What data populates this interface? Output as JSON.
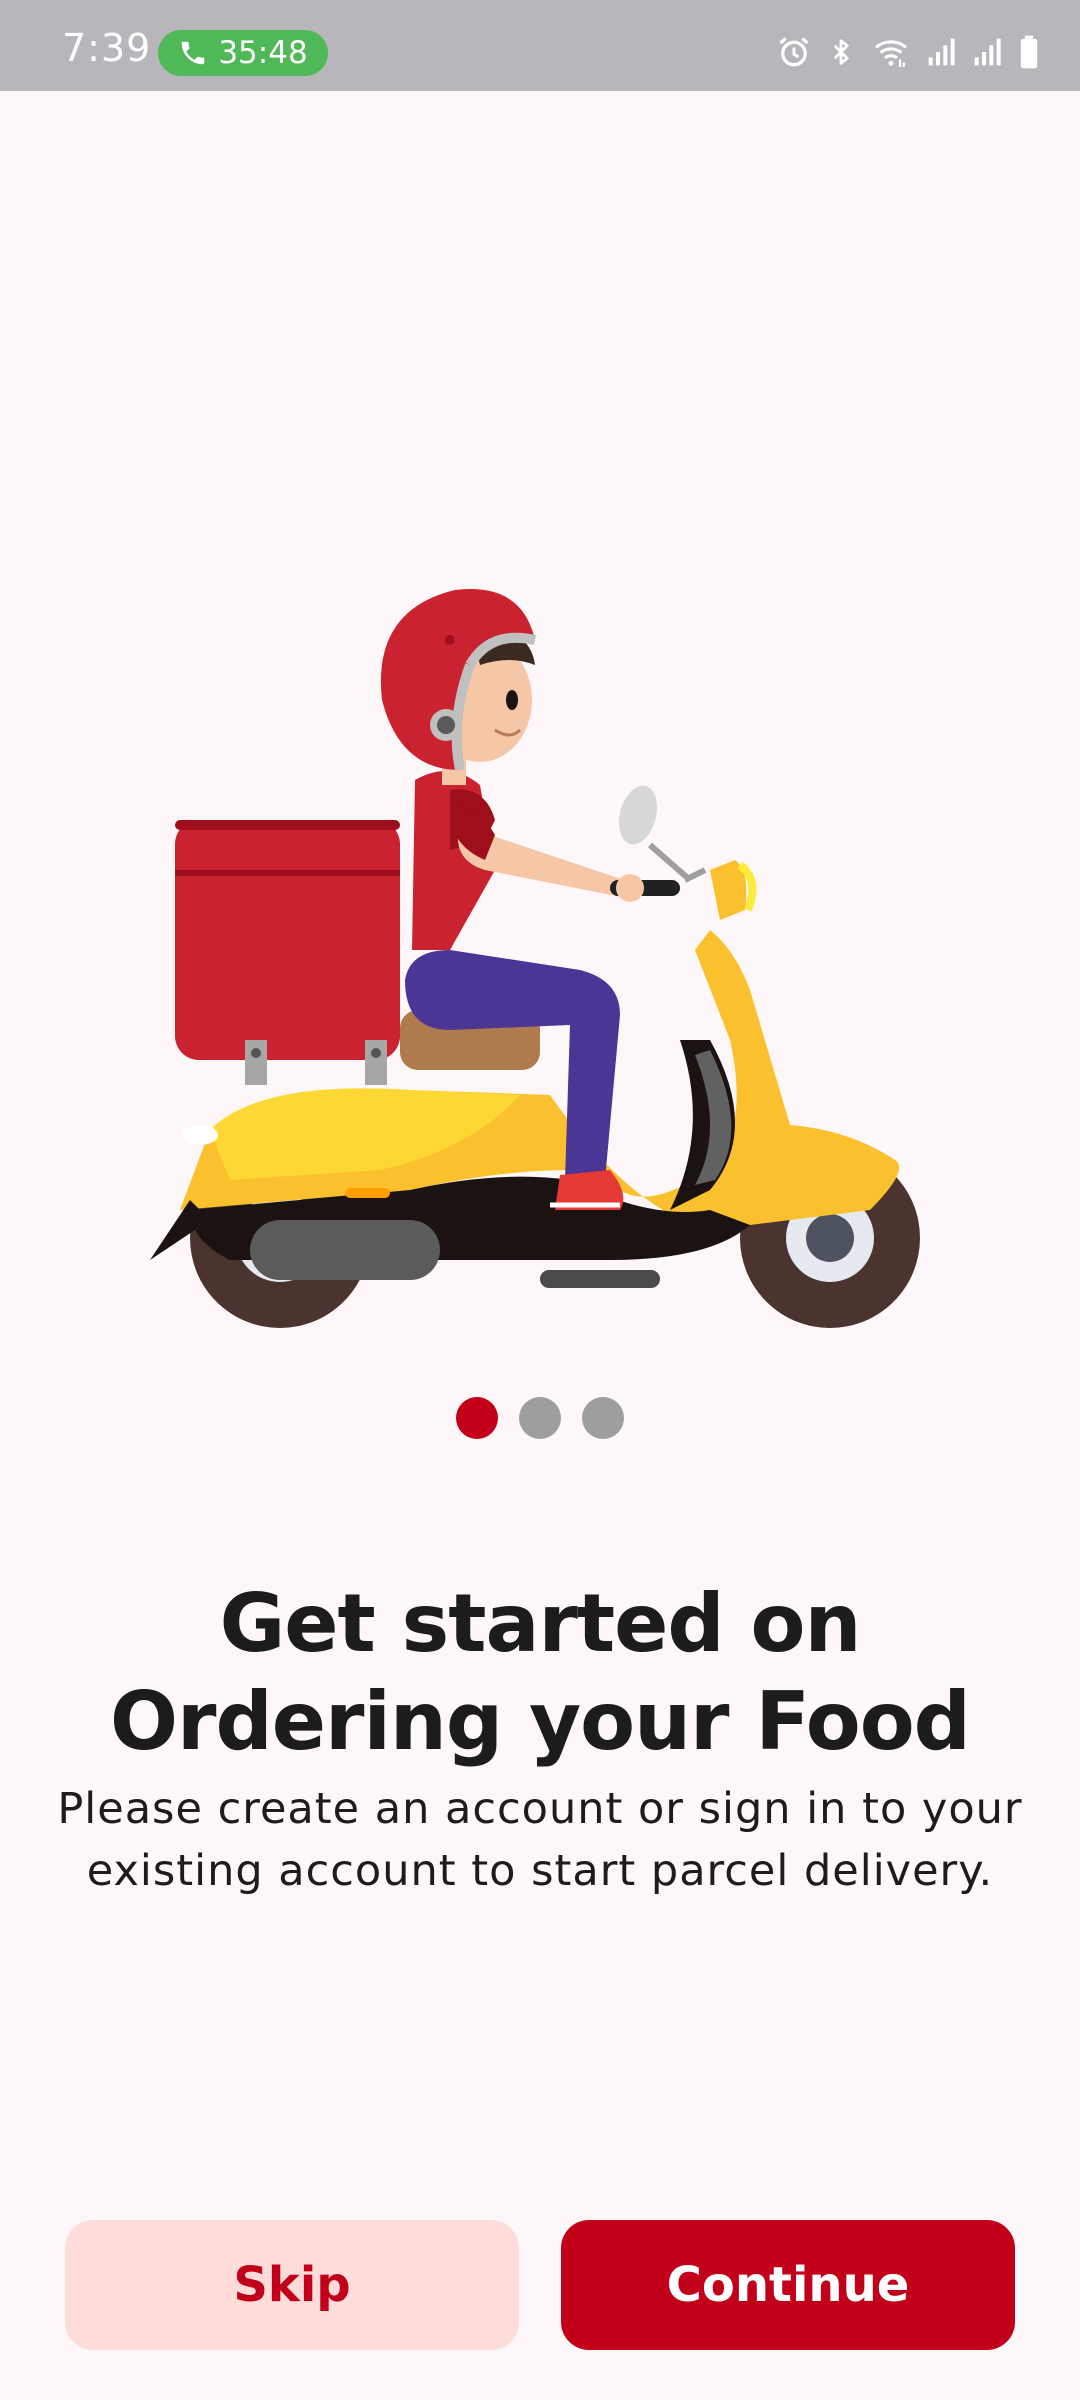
{
  "status_bar": {
    "time": "7:39",
    "call_duration": "35:48",
    "icons": [
      "phone-icon",
      "alarm-icon",
      "bluetooth-icon",
      "wifi-icon",
      "signal-icon",
      "signal-icon-2",
      "battery-icon"
    ]
  },
  "onboarding": {
    "illustration": "delivery-scooter-illustration",
    "page_indicator": {
      "current": 1,
      "total": 3
    },
    "title_line1": "Get started on",
    "title_line2": "Ordering your Food",
    "subtitle_line1": "Please create an account or sign in to your",
    "subtitle_line2": "existing account to start parcel delivery."
  },
  "actions": {
    "skip_label": "Skip",
    "continue_label": "Continue"
  },
  "colors": {
    "accent": "#c2001a",
    "skip_background": "#fddcd9",
    "background": "#fdf7f9",
    "status_bar": "#b8b6bb",
    "call_pill": "#4fb958"
  }
}
